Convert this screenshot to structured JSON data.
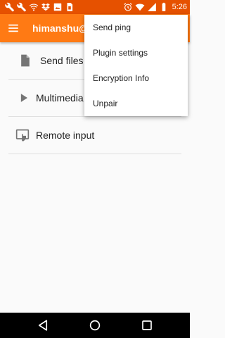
{
  "status_bar": {
    "time": "5:26",
    "left_icons": [
      "wrench-icon",
      "wrench-icon",
      "wifi-icon",
      "dropbox-icon",
      "image-icon",
      "sim-card-icon"
    ],
    "right_icons": [
      "alarm-icon",
      "wifi-signal-icon",
      "cell-signal-icon",
      "battery-icon"
    ]
  },
  "app_bar": {
    "title": "himanshu@",
    "menu_icon": "hamburger-icon"
  },
  "device_actions": [
    {
      "label": "Send files",
      "icon": "file-icon"
    },
    {
      "label": "Multimedia",
      "icon": "play-icon"
    },
    {
      "label": "Remote input",
      "icon": "touch-icon"
    }
  ],
  "overflow_menu": {
    "items": [
      "Send ping",
      "Plugin settings",
      "Encryption Info",
      "Unpair"
    ]
  },
  "nav_bar": {
    "buttons": [
      "back-icon",
      "home-icon",
      "recents-icon"
    ]
  },
  "colors": {
    "status_bar": "#e65100",
    "app_bar": "#ff7a14",
    "background": "#fafafa",
    "icon_gray": "#757575"
  }
}
